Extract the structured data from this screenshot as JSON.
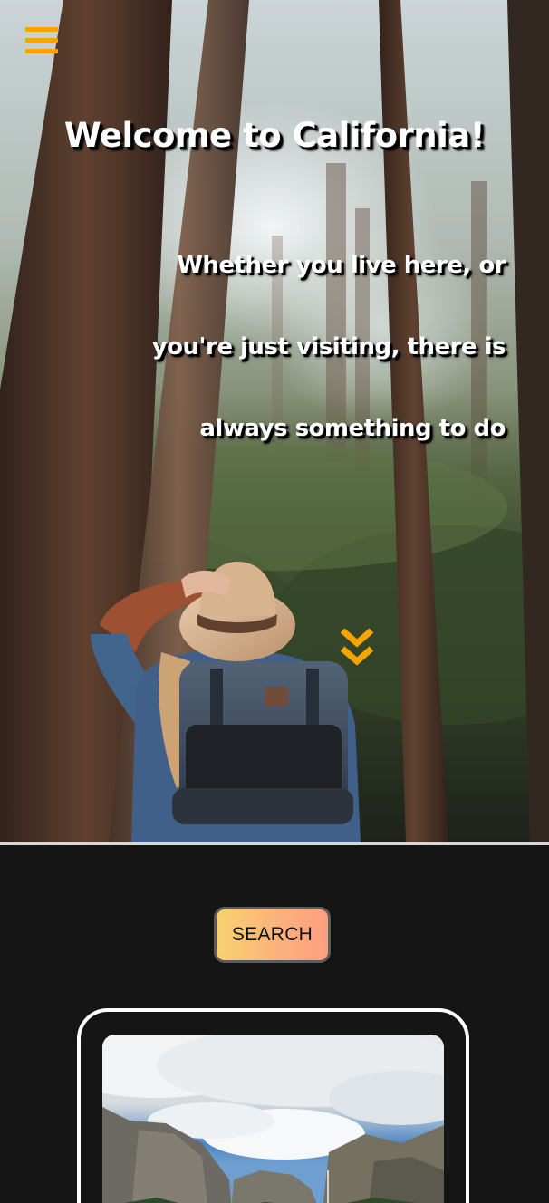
{
  "header": {
    "menu_icon": "hamburger-menu-icon"
  },
  "hero": {
    "title": "Welcome to California!",
    "subtitle": "Whether you live here, or you're just visiting, there is always something to do",
    "scroll_icon": "double-chevron-down-icon"
  },
  "search": {
    "label": "SEARCH"
  },
  "colors": {
    "accent": "#f5a400",
    "background": "#151515",
    "button_gradient_start": "#f8d26f",
    "button_gradient_end": "#ff9e80"
  }
}
